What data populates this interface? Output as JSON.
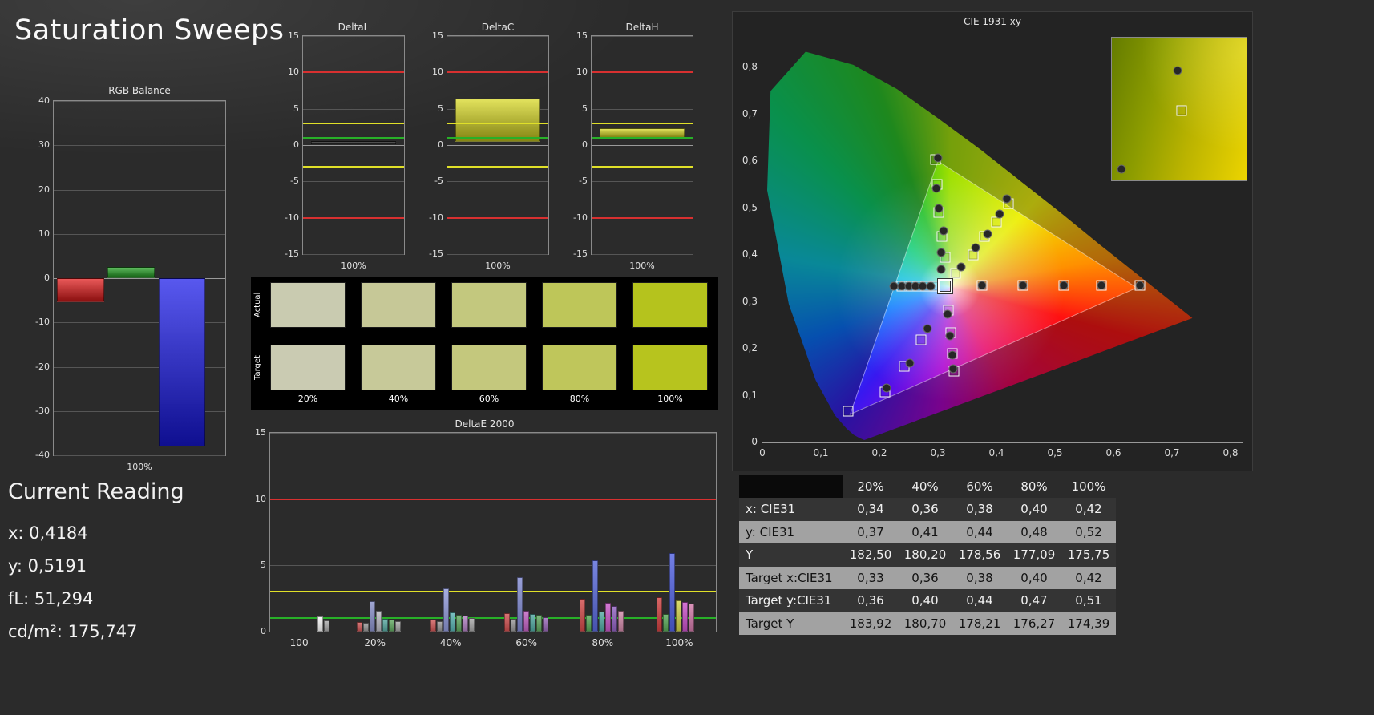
{
  "app": {
    "title": "Saturation Sweeps"
  },
  "rgb_balance": {
    "title": "RGB Balance",
    "x_label": "100%",
    "ylim": [
      -40,
      40
    ],
    "yticks": [
      40,
      30,
      20,
      10,
      0,
      -10,
      -20,
      -30,
      -40
    ],
    "bars": [
      {
        "name": "red",
        "value": -5.5,
        "color": "#e01818"
      },
      {
        "name": "green",
        "value": 2.5,
        "color": "#1f9e1f"
      },
      {
        "name": "blue",
        "value": -38,
        "color": "#1818e8"
      }
    ]
  },
  "current_reading": {
    "title": "Current Reading",
    "lines": [
      "x: 0,4184",
      "y: 0,5191",
      "fL: 51,294",
      "cd/m²: 175,747"
    ]
  },
  "delta_refs": {
    "red": [
      10,
      -10
    ],
    "yellow": [
      3,
      -3
    ],
    "green": [
      1
    ]
  },
  "delta_charts": [
    {
      "title": "DeltaL",
      "x_label": "100%",
      "ylim": [
        -15,
        15
      ],
      "yticks": [
        15,
        10,
        5,
        0,
        -5,
        -10,
        -15
      ],
      "bar": {
        "from": 0,
        "to": 0.6,
        "color": "#1c1c1c"
      }
    },
    {
      "title": "DeltaC",
      "x_label": "100%",
      "ylim": [
        -15,
        15
      ],
      "yticks": [
        15,
        10,
        5,
        0,
        -5,
        -10,
        -15
      ],
      "bar": {
        "from": 0.4,
        "to": 6.4,
        "color": "#d6d61e"
      }
    },
    {
      "title": "DeltaH",
      "x_label": "100%",
      "ylim": [
        -15,
        15
      ],
      "yticks": [
        15,
        10,
        5,
        0,
        -5,
        -10,
        -15
      ],
      "bar": {
        "from": 1.0,
        "to": 2.3,
        "color": "#d6d61e"
      }
    }
  ],
  "swatches": {
    "row_labels": [
      "Actual",
      "Target"
    ],
    "col_labels": [
      "20%",
      "40%",
      "60%",
      "80%",
      "100%"
    ],
    "actual": [
      "#c9cbb0",
      "#c6c897",
      "#c3c87e",
      "#bec659",
      "#b5c31d"
    ],
    "target": [
      "#cacbb2",
      "#c7c999",
      "#c4c87d",
      "#bfc65b",
      "#b7c41e"
    ]
  },
  "deltae_chart": {
    "title": "DeltaE 2000",
    "ylim": [
      0,
      15
    ],
    "yticks": [
      15,
      10,
      5,
      0
    ],
    "refs": {
      "red": 10,
      "yellow": 3,
      "green": 1
    },
    "x_labels": [
      "100",
      "20%",
      "40%",
      "60%",
      "80%",
      "100%"
    ],
    "x_positions": [
      6.5,
      23.5,
      40.5,
      57.5,
      74.6,
      91.8
    ],
    "clusters": [
      {
        "x": 12,
        "bars": [
          {
            "v": 1.15,
            "c": "#f5f5f5"
          },
          {
            "v": 0.85,
            "c": "#a8a8a8"
          }
        ]
      },
      {
        "x": 24.5,
        "bars": [
          {
            "v": 0.75,
            "c": "#d05858"
          },
          {
            "v": 0.65,
            "c": "#989898"
          },
          {
            "v": 2.3,
            "c": "#8890c8"
          },
          {
            "v": 1.55,
            "c": "#b9b9c2"
          },
          {
            "v": 0.95,
            "c": "#58a8a0"
          },
          {
            "v": 0.9,
            "c": "#60a860"
          },
          {
            "v": 0.8,
            "c": "#a8a8a8"
          }
        ]
      },
      {
        "x": 41,
        "bars": [
          {
            "v": 0.9,
            "c": "#d05858"
          },
          {
            "v": 0.8,
            "c": "#989898"
          },
          {
            "v": 3.25,
            "c": "#9098d8"
          },
          {
            "v": 1.45,
            "c": "#58b0b0"
          },
          {
            "v": 1.3,
            "c": "#60a860"
          },
          {
            "v": 1.2,
            "c": "#b080c0"
          },
          {
            "v": 1.05,
            "c": "#a8a8a8"
          }
        ]
      },
      {
        "x": 57.5,
        "bars": [
          {
            "v": 1.4,
            "c": "#d05050"
          },
          {
            "v": 0.95,
            "c": "#989898"
          },
          {
            "v": 4.1,
            "c": "#8088d0"
          },
          {
            "v": 1.55,
            "c": "#c060c0"
          },
          {
            "v": 1.35,
            "c": "#50a8a0"
          },
          {
            "v": 1.25,
            "c": "#60a860"
          },
          {
            "v": 1.1,
            "c": "#9868b8"
          }
        ]
      },
      {
        "x": 74.5,
        "bars": [
          {
            "v": 2.5,
            "c": "#d04848"
          },
          {
            "v": 1.3,
            "c": "#58a858"
          },
          {
            "v": 5.4,
            "c": "#5868d8"
          },
          {
            "v": 1.5,
            "c": "#50a8a0"
          },
          {
            "v": 2.2,
            "c": "#c858c8"
          },
          {
            "v": 1.95,
            "c": "#9060c0"
          },
          {
            "v": 1.6,
            "c": "#d088a8"
          }
        ]
      },
      {
        "x": 91,
        "bars": [
          {
            "v": 2.6,
            "c": "#d04040"
          },
          {
            "v": 1.35,
            "c": "#58a858"
          },
          {
            "v": 5.9,
            "c": "#5060e0"
          },
          {
            "v": 2.35,
            "c": "#d0d048"
          },
          {
            "v": 2.25,
            "c": "#c850c8"
          },
          {
            "v": 2.1,
            "c": "#d078a8"
          }
        ]
      }
    ]
  },
  "cie": {
    "title": "CIE 1931 xy",
    "x_ticks": [
      "0",
      "0,1",
      "0,2",
      "0,3",
      "0,4",
      "0,5",
      "0,6",
      "0,7",
      "0,8"
    ],
    "y_ticks": [
      "0",
      "0,1",
      "0,2",
      "0,3",
      "0,4",
      "0,5",
      "0,6",
      "0,7",
      "0,8"
    ],
    "triangle": [
      [
        0.64,
        0.33
      ],
      [
        0.3,
        0.6
      ],
      [
        0.15,
        0.06
      ]
    ],
    "current": [
      0.313,
      0.333
    ],
    "targets": [
      [
        0.375,
        0.335
      ],
      [
        0.445,
        0.335
      ],
      [
        0.515,
        0.335
      ],
      [
        0.58,
        0.335
      ],
      [
        0.645,
        0.335
      ],
      [
        0.33,
        0.36
      ],
      [
        0.36,
        0.4
      ],
      [
        0.38,
        0.44
      ],
      [
        0.4,
        0.47
      ],
      [
        0.42,
        0.51
      ],
      [
        0.312,
        0.395
      ],
      [
        0.307,
        0.44
      ],
      [
        0.302,
        0.49
      ],
      [
        0.298,
        0.55
      ],
      [
        0.296,
        0.603
      ],
      [
        0.295,
        0.333
      ],
      [
        0.28,
        0.333
      ],
      [
        0.266,
        0.333
      ],
      [
        0.252,
        0.333
      ],
      [
        0.238,
        0.333
      ],
      [
        0.271,
        0.218
      ],
      [
        0.243,
        0.162
      ],
      [
        0.21,
        0.108
      ],
      [
        0.147,
        0.067
      ],
      [
        0.318,
        0.282
      ],
      [
        0.322,
        0.235
      ],
      [
        0.325,
        0.19
      ],
      [
        0.327,
        0.152
      ]
    ],
    "measurements": [
      [
        0.34,
        0.375
      ],
      [
        0.365,
        0.415
      ],
      [
        0.385,
        0.445
      ],
      [
        0.405,
        0.487
      ],
      [
        0.418,
        0.519
      ],
      [
        0.306,
        0.37
      ],
      [
        0.305,
        0.405
      ],
      [
        0.31,
        0.452
      ],
      [
        0.302,
        0.5
      ],
      [
        0.297,
        0.542
      ],
      [
        0.3,
        0.607
      ],
      [
        0.225,
        0.333
      ],
      [
        0.238,
        0.333
      ],
      [
        0.25,
        0.333
      ],
      [
        0.262,
        0.333
      ],
      [
        0.274,
        0.333
      ],
      [
        0.287,
        0.333
      ],
      [
        0.282,
        0.243
      ],
      [
        0.252,
        0.17
      ],
      [
        0.213,
        0.117
      ],
      [
        0.316,
        0.273
      ],
      [
        0.32,
        0.228
      ],
      [
        0.324,
        0.186
      ],
      [
        0.326,
        0.158
      ],
      [
        0.375,
        0.335
      ],
      [
        0.445,
        0.335
      ],
      [
        0.515,
        0.335
      ],
      [
        0.58,
        0.335
      ],
      [
        0.645,
        0.335
      ]
    ],
    "inset": {
      "squares": [
        [
          0.52,
          0.51
        ]
      ],
      "circles": [
        [
          0.49,
          0.23
        ],
        [
          0.07,
          0.92
        ]
      ]
    }
  },
  "table": {
    "col_headers": [
      "",
      "20%",
      "40%",
      "60%",
      "80%",
      "100%"
    ],
    "rows": [
      {
        "label": "x: CIE31",
        "values": [
          "0,34",
          "0,36",
          "0,38",
          "0,40",
          "0,42"
        ],
        "shade": "dark"
      },
      {
        "label": "y: CIE31",
        "values": [
          "0,37",
          "0,41",
          "0,44",
          "0,48",
          "0,52"
        ],
        "shade": "light"
      },
      {
        "label": "Y",
        "values": [
          "182,50",
          "180,20",
          "178,56",
          "177,09",
          "175,75"
        ],
        "shade": "dark"
      },
      {
        "label": "Target x:CIE31",
        "values": [
          "0,33",
          "0,36",
          "0,38",
          "0,40",
          "0,42"
        ],
        "shade": "light"
      },
      {
        "label": "Target y:CIE31",
        "values": [
          "0,36",
          "0,40",
          "0,44",
          "0,47",
          "0,51"
        ],
        "shade": "dark"
      },
      {
        "label": "Target Y",
        "values": [
          "183,92",
          "180,70",
          "178,21",
          "176,27",
          "174,39"
        ],
        "shade": "light"
      }
    ]
  }
}
